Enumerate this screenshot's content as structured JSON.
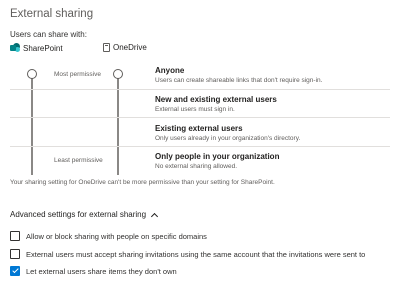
{
  "page": {
    "title": "External sharing",
    "subtitle": "Users can share with:"
  },
  "apps": {
    "sharepoint": "SharePoint",
    "onedrive": "OneDrive"
  },
  "slider": {
    "most_permissive": "Most permissive",
    "least_permissive": "Least permissive"
  },
  "options": [
    {
      "title": "Anyone",
      "description": "Users can create shareable links that don't require sign-in."
    },
    {
      "title": "New and existing external users",
      "description": "External users must sign in."
    },
    {
      "title": "Existing external users",
      "description": "Only users already in your organization's directory."
    },
    {
      "title": "Only people in your organization",
      "description": "No external sharing allowed."
    }
  ],
  "footnote": "Your sharing setting for OneDrive can't be more permissive than your setting for SharePoint.",
  "advanced": {
    "label": "Advanced settings for external sharing",
    "checkboxes": [
      {
        "label": "Allow or block sharing with people on specific domains",
        "checked": false
      },
      {
        "label": "External users must accept sharing invitations using the same account that the invitations were sent to",
        "checked": false
      },
      {
        "label": "Let external users share items they don't own",
        "checked": true
      }
    ]
  },
  "colors": {
    "accent": "#0078d4",
    "sharepoint": "#038387"
  },
  "icons": [
    "sharepoint-icon",
    "onedrive-icon",
    "chevron-up-icon",
    "checkbox-icon"
  ]
}
